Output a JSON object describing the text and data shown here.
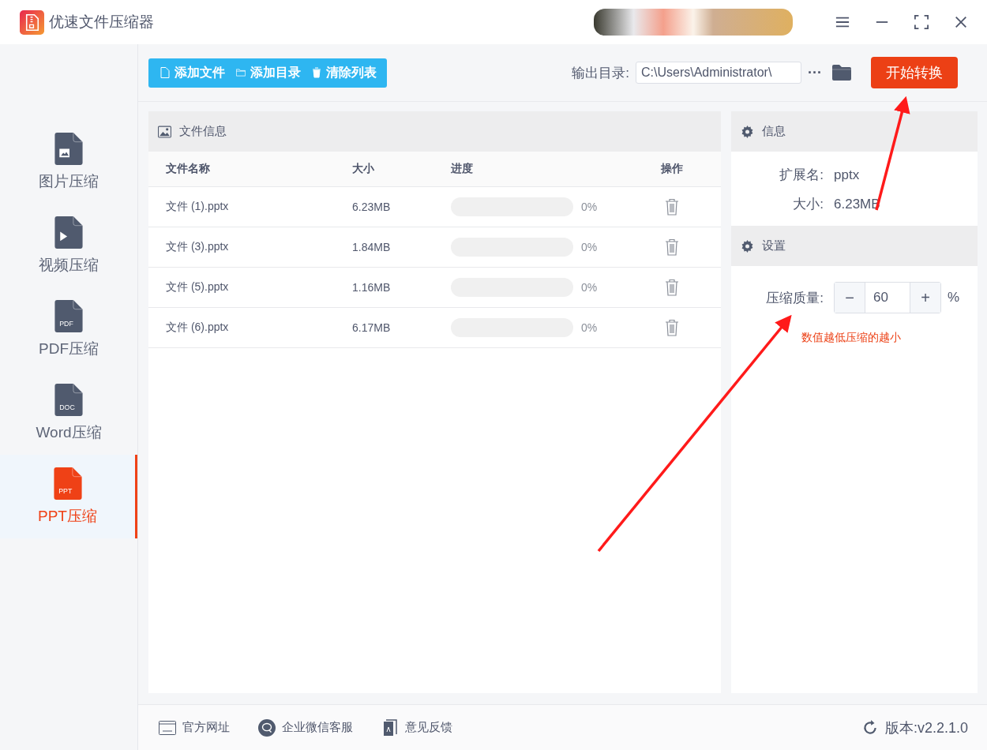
{
  "window": {
    "title": "优速文件压缩器"
  },
  "sidebar": {
    "items": [
      {
        "label": "图片压缩",
        "kind": "image",
        "selected": false
      },
      {
        "label": "视频压缩",
        "kind": "video",
        "selected": false
      },
      {
        "label": "PDF压缩",
        "kind": "text",
        "icon_label": "PDF",
        "selected": false
      },
      {
        "label": "Word压缩",
        "kind": "text",
        "icon_label": "DOC",
        "selected": false
      },
      {
        "label": "PPT压缩",
        "kind": "text",
        "icon_label": "PPT",
        "selected": true
      }
    ]
  },
  "toolbar": {
    "buttons": [
      {
        "label": "添加文件",
        "kind": "file"
      },
      {
        "label": "添加目录",
        "kind": "folder"
      },
      {
        "label": "清除列表",
        "kind": "trash"
      }
    ],
    "output_label": "输出目录:",
    "output_path": "C:\\Users\\Administrator\\",
    "more": "···",
    "start_button": "开始转换"
  },
  "file_panel": {
    "title": "文件信息",
    "columns": [
      "文件名称",
      "大小",
      "进度",
      "操作"
    ],
    "rows": [
      {
        "name": "文件 (1).pptx",
        "size": "6.23MB",
        "level": 0,
        "reading": "0%"
      },
      {
        "name": "文件 (3).pptx",
        "size": "1.84MB",
        "level": 0,
        "reading": "0%"
      },
      {
        "name": "文件 (5).pptx",
        "size": "1.16MB",
        "level": 0,
        "reading": "0%"
      },
      {
        "name": "文件 (6).pptx",
        "size": "6.17MB",
        "level": 0,
        "reading": "0%"
      }
    ]
  },
  "info_panel": {
    "title": "信息",
    "fields": [
      {
        "label": "扩展名:",
        "value": "pptx"
      },
      {
        "label": "大小:",
        "value": "6.23MB"
      }
    ]
  },
  "settings_panel": {
    "title": "设置",
    "quality_label": "压缩质量:",
    "minus": "−",
    "value": "60",
    "plus": "+",
    "unit": "%",
    "hint": "数值越低压缩的越小"
  },
  "footer": {
    "links": [
      {
        "label": "官方网址",
        "kind": "web"
      },
      {
        "label": "企业微信客服",
        "kind": "chat"
      },
      {
        "label": "意见反馈",
        "kind": "feedback"
      }
    ],
    "version": "版本:v2.2.1.0"
  }
}
